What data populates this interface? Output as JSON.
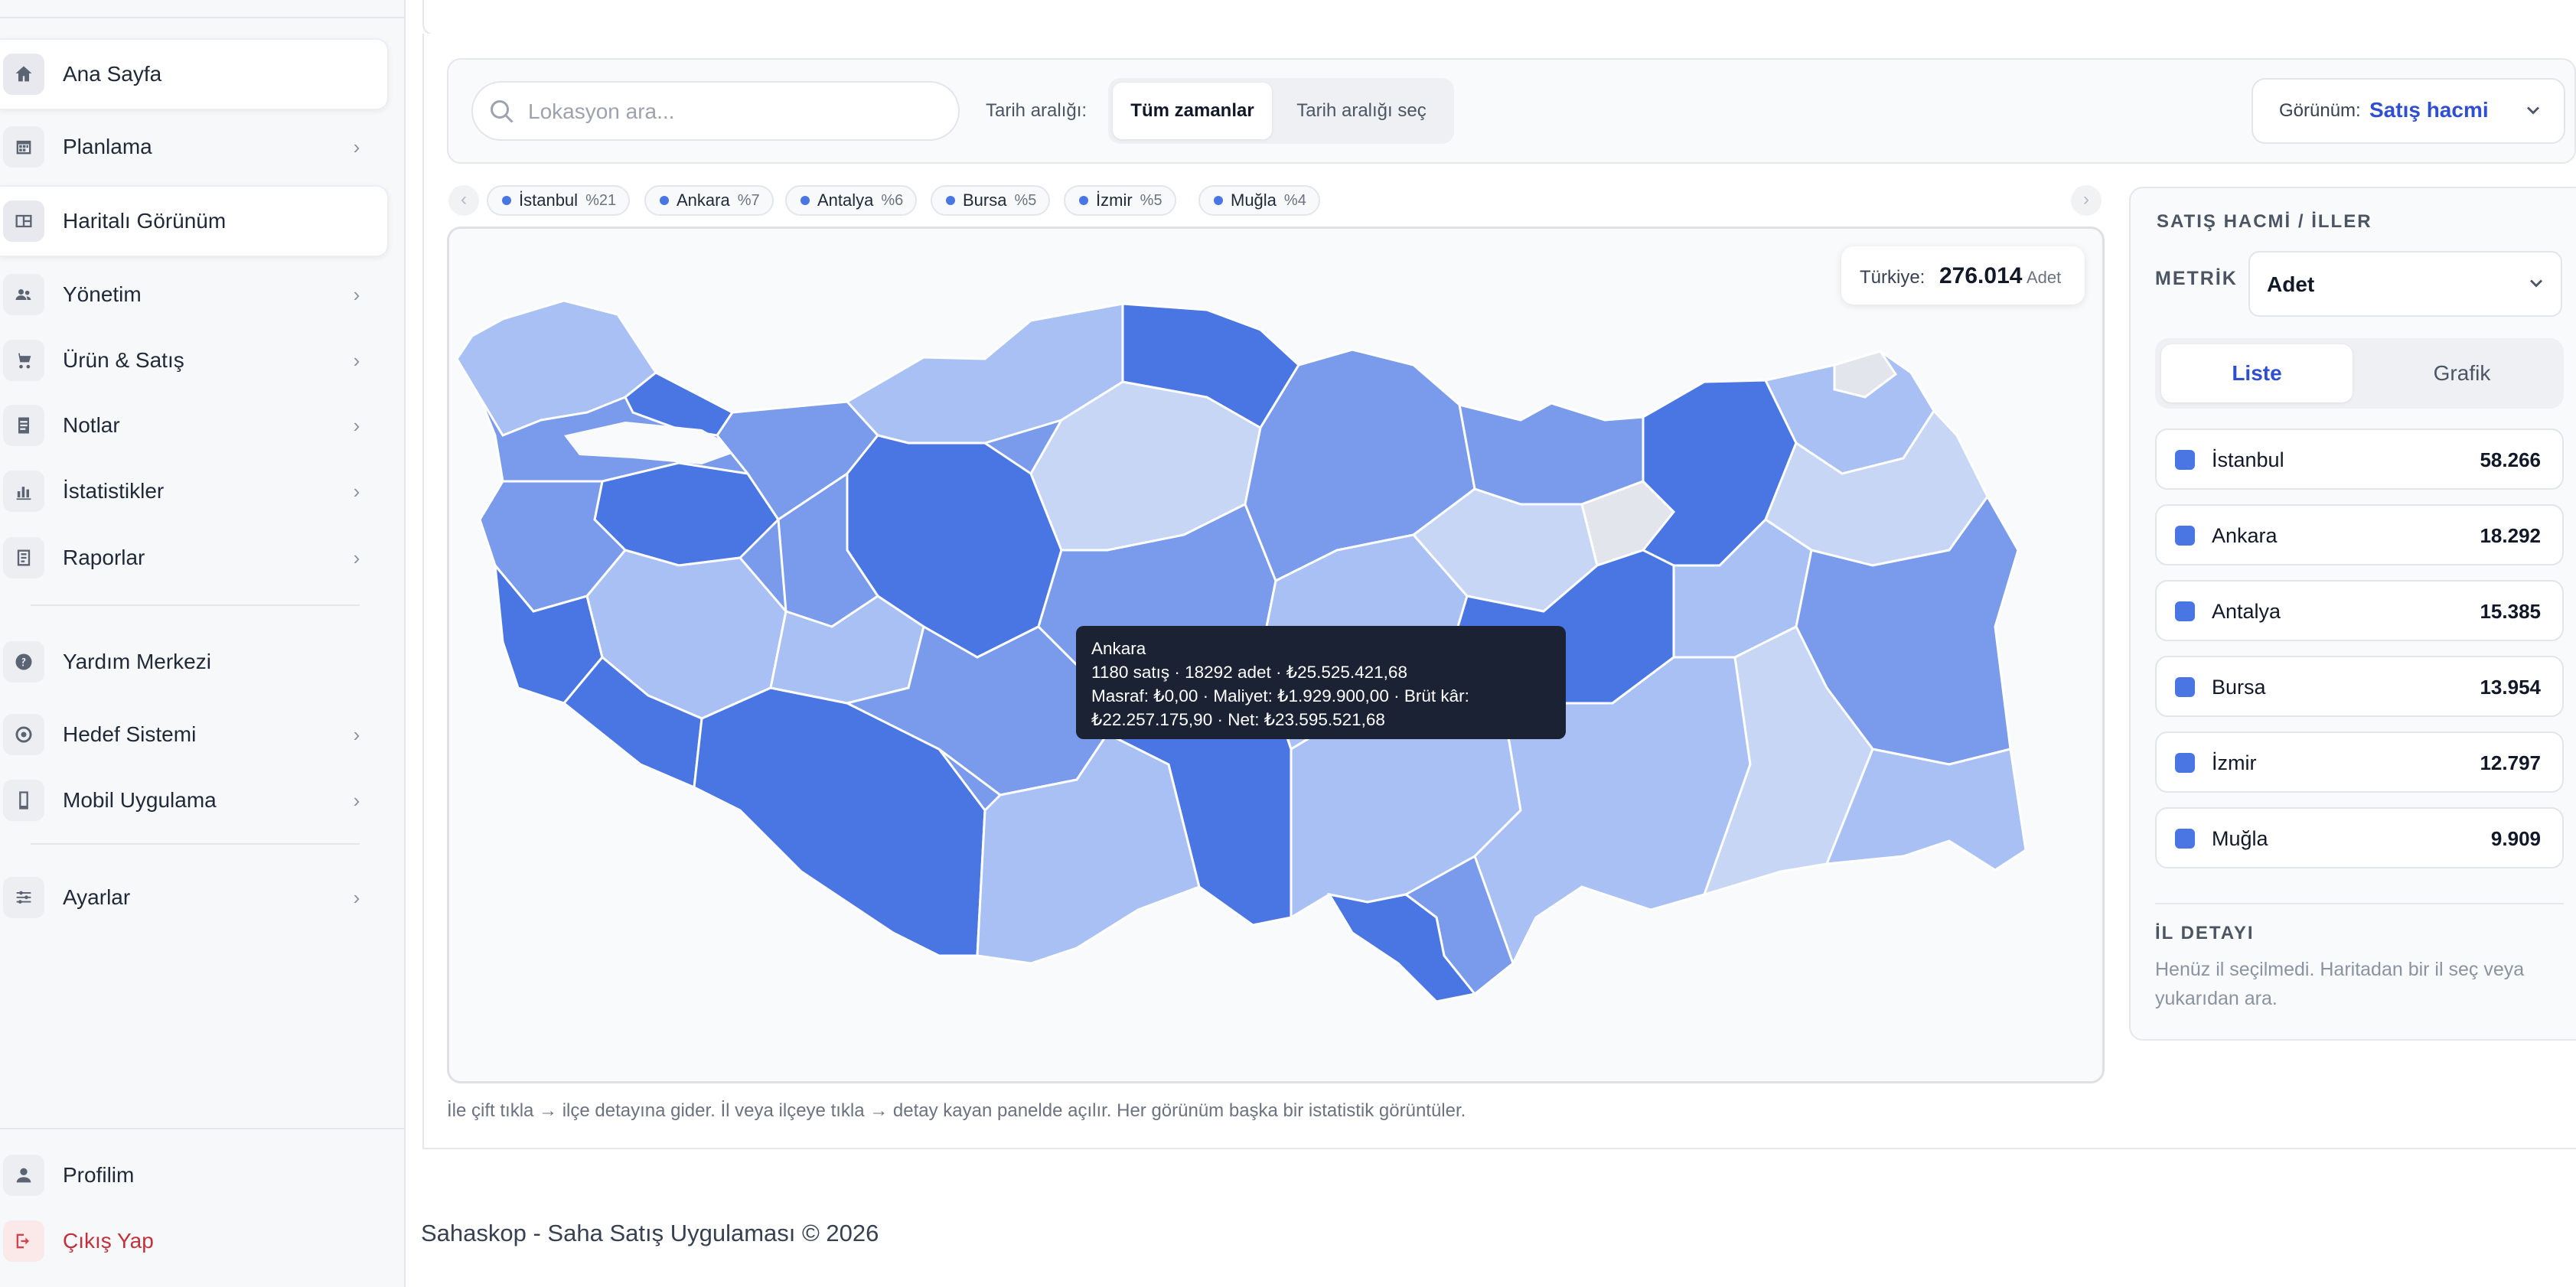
{
  "sidebar": {
    "items": [
      {
        "label": "Ana Sayfa",
        "icon": "home-icon"
      },
      {
        "label": "Planlama",
        "icon": "calendar-icon"
      },
      {
        "label": "Haritalı Görünüm",
        "icon": "map-icon"
      },
      {
        "label": "Yönetim",
        "icon": "users-icon"
      },
      {
        "label": "Ürün & Satış",
        "icon": "cart-icon"
      },
      {
        "label": "Notlar",
        "icon": "note-icon"
      },
      {
        "label": "İstatistikler",
        "icon": "bar-chart-icon"
      },
      {
        "label": "Raporlar",
        "icon": "report-icon"
      },
      {
        "label": "Yardım Merkezi",
        "icon": "help-icon"
      },
      {
        "label": "Hedef Sistemi",
        "icon": "target-icon"
      },
      {
        "label": "Mobil Uygulama",
        "icon": "mobile-icon"
      },
      {
        "label": "Ayarlar",
        "icon": "sliders-icon"
      }
    ],
    "profile": "Profilim",
    "logout": "Çıkış Yap"
  },
  "toolbar": {
    "search_placeholder": "Lokasyon ara...",
    "date_label": "Tarih aralığı:",
    "date_all": "Tüm zamanlar",
    "date_pick": "Tarih aralığı seç",
    "view_label": "Görünüm:",
    "view_value": "Satış hacmi"
  },
  "chips": [
    {
      "name": "İstanbul",
      "pct": "%21"
    },
    {
      "name": "Ankara",
      "pct": "%7"
    },
    {
      "name": "Antalya",
      "pct": "%6"
    },
    {
      "name": "Bursa",
      "pct": "%5"
    },
    {
      "name": "İzmir",
      "pct": "%5"
    },
    {
      "name": "Muğla",
      "pct": "%4"
    }
  ],
  "map": {
    "total_label": "Türkiye:",
    "total_value": "276.014",
    "total_unit": "Adet",
    "tooltip": {
      "title": "Ankara",
      "line1": "1180 satış · 18292 adet · ₺25.525.421,68",
      "line2": "Masraf: ₺0,00 · Maliyet: ₺1.929.900,00 · Brüt kâr:",
      "line3": "₺22.257.175,90 · Net: ₺23.595.521,68"
    },
    "hint": "İle çift tıkla → ilçe detayına gider. İl veya ilçeye tıkla → detay kayan panelde açılır. Her görünüm başka bir istatistik görüntüler."
  },
  "panel": {
    "title": "SATIŞ HACMİ / İLLER",
    "metric_label": "METRİK",
    "metric_value": "Adet",
    "tab_list": "Liste",
    "tab_chart": "Grafik",
    "rows": [
      {
        "name": "İstanbul",
        "value": "58.266"
      },
      {
        "name": "Ankara",
        "value": "18.292"
      },
      {
        "name": "Antalya",
        "value": "15.385"
      },
      {
        "name": "Bursa",
        "value": "13.954"
      },
      {
        "name": "İzmir",
        "value": "12.797"
      },
      {
        "name": "Muğla",
        "value": "9.909"
      }
    ],
    "detail_title": "İL DETAYI",
    "detail_text": "Henüz il seçilmedi. Haritadan bir il seç veya yukarıdan ara."
  },
  "footer": {
    "copyright": "Sahaskop - Saha Satış Uygulaması © 2026"
  },
  "colors": {
    "accent": "#2e4fd1",
    "map_dark": "#4a76e4",
    "map_mid": "#7a9bec",
    "map_light": "#a9c0f4",
    "map_pale": "#c8d6f6",
    "map_empty": "#e2e6ec",
    "tooltip_bg": "#1a2234",
    "logout": "#c2303a"
  }
}
